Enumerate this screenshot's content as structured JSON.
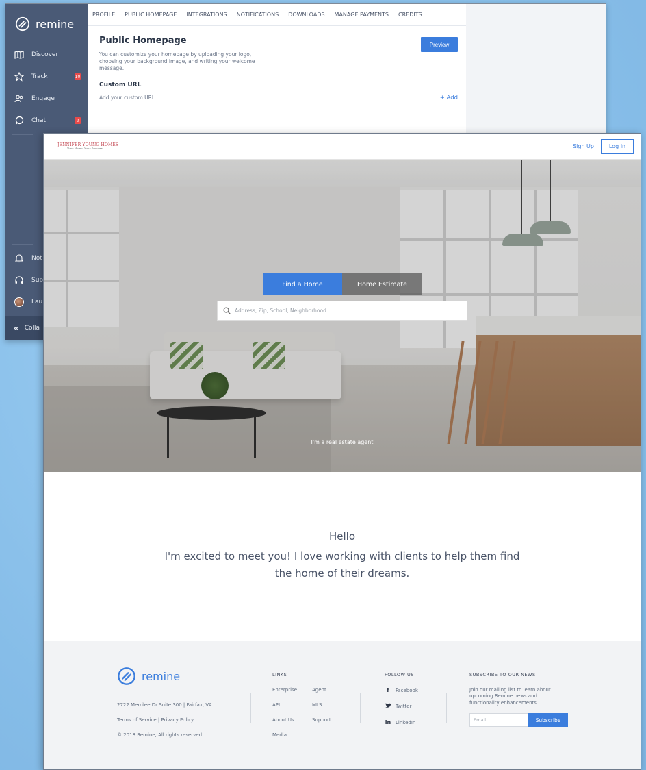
{
  "back_window": {
    "logo_text": "remine",
    "sidebar": {
      "items": [
        {
          "label": "Discover",
          "icon": "map-icon"
        },
        {
          "label": "Track",
          "icon": "star-icon",
          "badge": "10"
        },
        {
          "label": "Engage",
          "icon": "people-icon"
        },
        {
          "label": "Chat",
          "icon": "chat-bubble-icon",
          "badge": "2"
        }
      ],
      "bottom_items": [
        {
          "label": "Not",
          "icon": "bell-icon"
        },
        {
          "label": "Sup",
          "icon": "headset-icon"
        },
        {
          "label": "Lau",
          "icon": "avatar"
        }
      ],
      "collapse_label": "Colla"
    },
    "tabs": [
      "PROFILE",
      "PUBLIC HOMEPAGE",
      "INTEGRATIONS",
      "NOTIFICATIONS",
      "DOWNLOADS",
      "MANAGE PAYMENTS",
      "CREDITS"
    ],
    "section_title": "Public Homepage",
    "section_desc": "You can customize your homepage by uploading your logo, choosing your background image, and writing your welcome message.",
    "preview_label": "Preview",
    "custom_url_title": "Custom URL",
    "custom_url_desc": "Add your custom URL.",
    "add_label": "+ Add"
  },
  "front_window": {
    "brand": {
      "name": "JENNIFER YOUNG HOMES",
      "tagline": "Your Home. Your Success."
    },
    "signup_label": "Sign Up",
    "login_label": "Log In",
    "hero": {
      "tab_find": "Find a Home",
      "tab_estimate": "Home Estimate",
      "search_placeholder": "Address, Zip, School, Neighborhood",
      "agent_link": "I'm a real estate agent"
    },
    "welcome": {
      "hello": "Hello",
      "message": "I'm excited to meet you! I love working with clients to help them find the home of their dreams."
    },
    "footer": {
      "logo_text": "remine",
      "address": "2722 Merrilee Dr Suite 300 | Fairfax, VA",
      "legal": "Terms of Service | Privacy Policy",
      "copyright": "© 2018 Remine, All rights reserved",
      "links_heading": "LINKS",
      "links": [
        "Enterprise",
        "Agent",
        "API",
        "MLS",
        "About Us",
        "Support",
        "Media"
      ],
      "follow_heading": "FOLLOW US",
      "social": [
        {
          "label": "Facebook",
          "icon": "facebook-icon",
          "glyph": "f"
        },
        {
          "label": "Twitter",
          "icon": "twitter-icon",
          "glyph": "t"
        },
        {
          "label": "LinkedIn",
          "icon": "linkedin-icon",
          "glyph": "in"
        }
      ],
      "subscribe_heading": "SUBSCRIBE TO OUR NEWS",
      "subscribe_text": "Join our mailing list to learn about upcoming Remine news and functionality enhancements",
      "email_placeholder": "Email",
      "subscribe_label": "Subscribe"
    }
  },
  "colors": {
    "accent": "#3b7ddd",
    "sidebar": "#4a5a76",
    "badge": "#e84b4b",
    "brand_red": "#c2444f"
  }
}
